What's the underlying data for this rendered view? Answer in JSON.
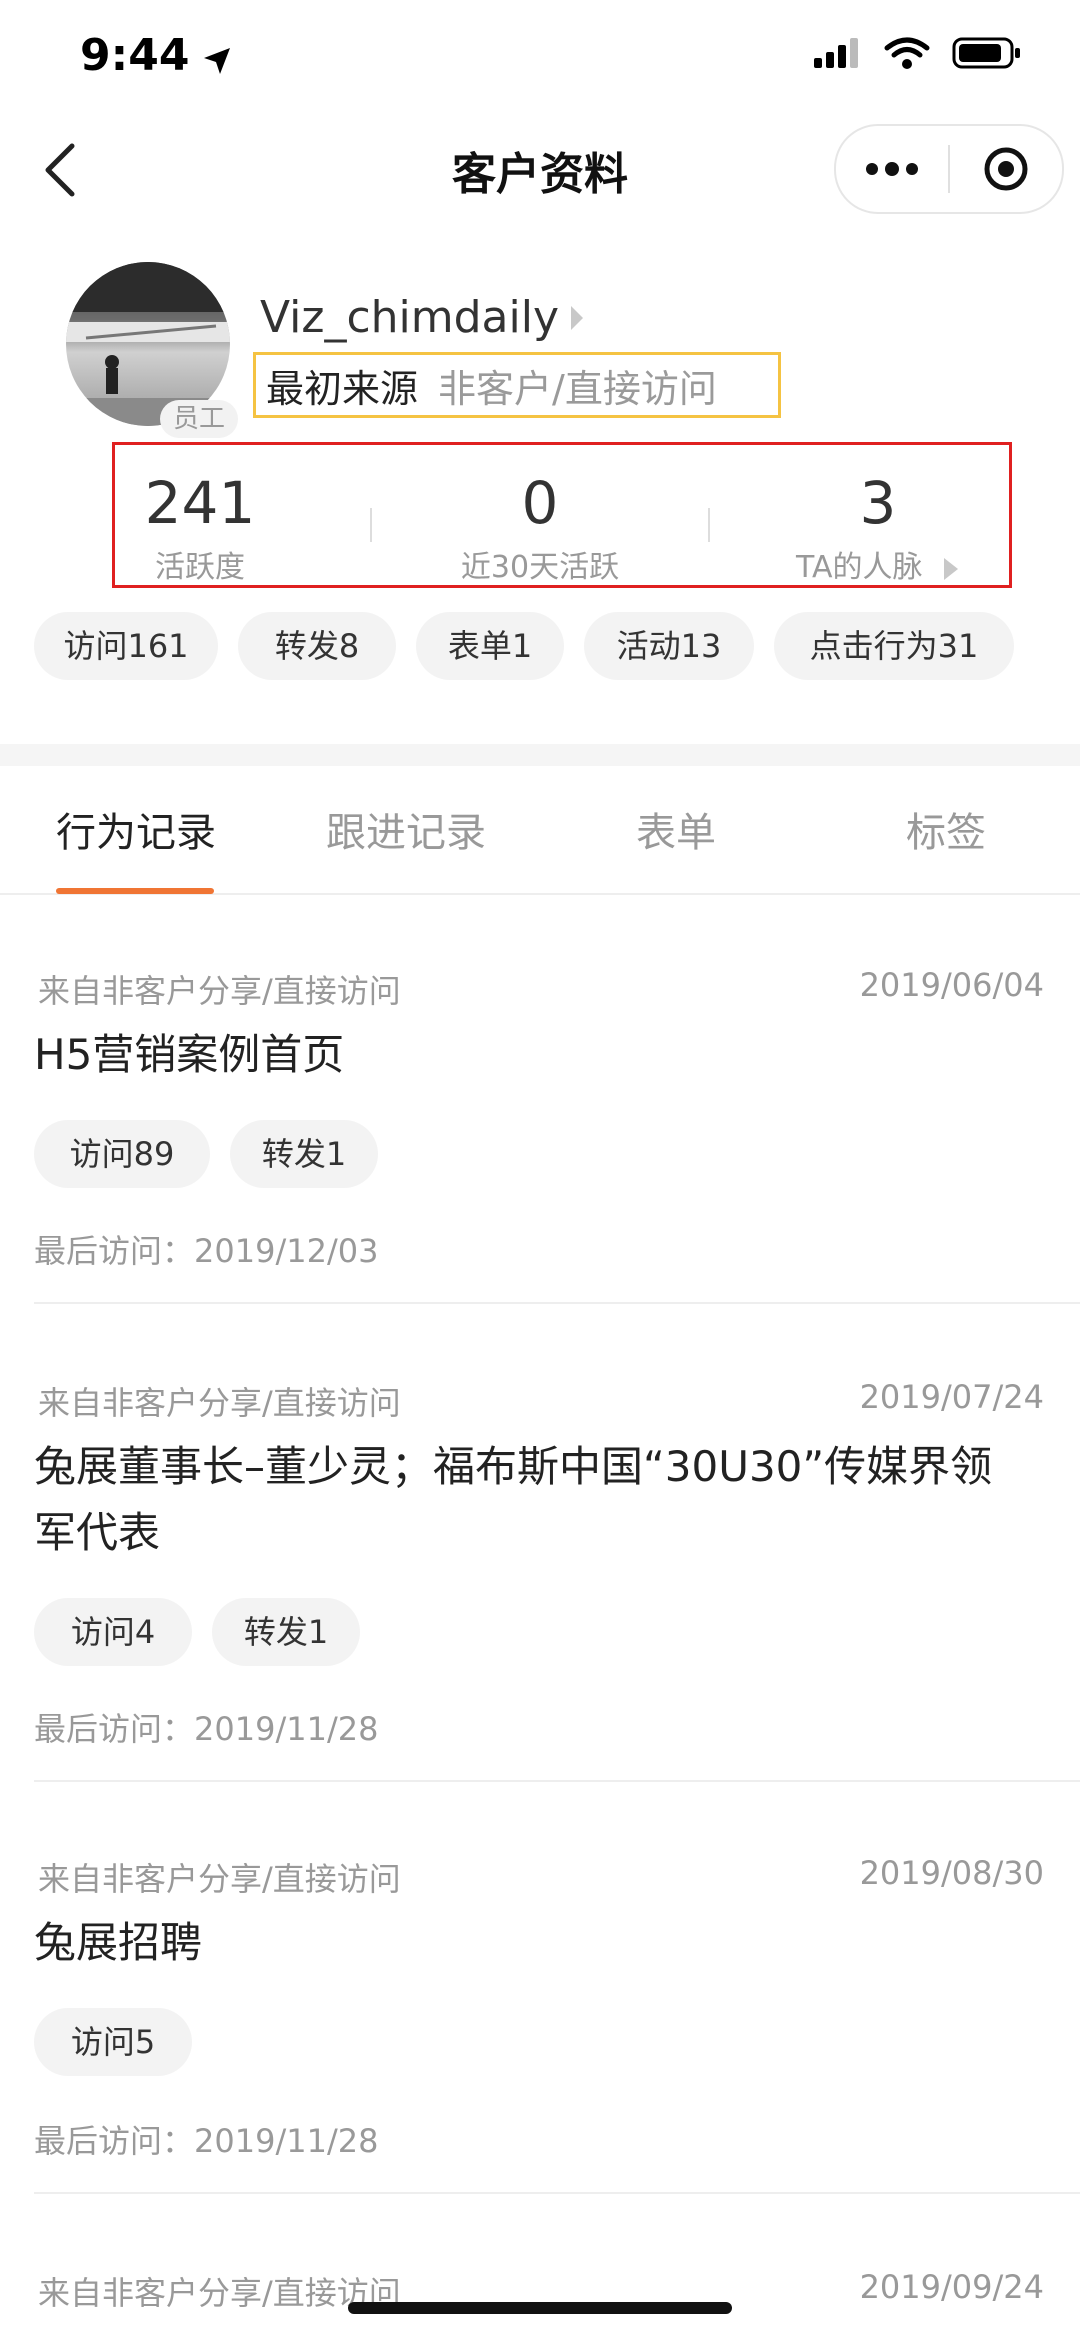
{
  "status_bar": {
    "time": "9:44"
  },
  "nav": {
    "title": "客户资料"
  },
  "profile": {
    "username": "Viz_chimdaily",
    "badge": "员工",
    "origin_label": "最初来源",
    "origin_value": "非客户/直接访问"
  },
  "stats": [
    {
      "value": "241",
      "label": "活跃度"
    },
    {
      "value": "0",
      "label": "近30天活跃"
    },
    {
      "value": "3",
      "label": "TA的人脉"
    }
  ],
  "chips": [
    "访问161",
    "转发8",
    "表单1",
    "活动13",
    "点击行为31"
  ],
  "tabs": [
    "行为记录",
    "跟进记录",
    "表单",
    "标签"
  ],
  "active_tab": "行为记录",
  "records": [
    {
      "source": "来自非客户分享/直接访问",
      "date": "2019/06/04",
      "title": "H5营销案例首页",
      "chips": [
        "访问89",
        "转发1"
      ],
      "last_visit": "最后访问：2019/12/03"
    },
    {
      "source": "来自非客户分享/直接访问",
      "date": "2019/07/24",
      "title": "兔展董事长–董少灵；福布斯中国“30U30”传媒界领军代表",
      "chips": [
        "访问4",
        "转发1"
      ],
      "last_visit": "最后访问：2019/11/28"
    },
    {
      "source": "来自非客户分享/直接访问",
      "date": "2019/08/30",
      "title": "兔展招聘",
      "chips": [
        "访问5"
      ],
      "last_visit": "最后访问：2019/11/28"
    },
    {
      "source": "来自非客户分享/直接访问",
      "date": "2019/09/24"
    }
  ],
  "colors": {
    "accent": "#f07534",
    "origin_border": "#f5c342",
    "stats_border": "#e02020"
  }
}
